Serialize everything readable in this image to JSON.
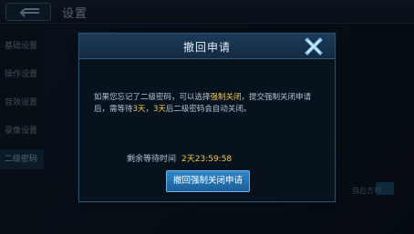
{
  "screen": {
    "title": "设置",
    "sidebar": [
      "基础设置",
      "操作设置",
      "音效设置",
      "录像设置",
      "二级密码"
    ],
    "active_sidebar_index": 4,
    "bg_fragment": "自后方可"
  },
  "dialog": {
    "title": "撤回申请",
    "message_part1": "如果您忘记了二级密码，可以选择",
    "message_hl1": "强制关闭",
    "message_part2": "，提交强制关闭申请后，需等待",
    "message_hl2": "3天",
    "message_part3": "，",
    "message_hl3": "3天",
    "message_part4": "后二级密码会自动关闭。",
    "remaining_label": "剩余等待时间",
    "remaining_time": "2天23:59:58",
    "revoke_button": "撤回强制关闭申请"
  },
  "colors": {
    "accent_yellow": "#f2c94c",
    "button_blue": "#2f86c9",
    "header_blue": "#1d3a57"
  },
  "icons": {
    "back": "back-arrow-icon",
    "close": "close-x-icon"
  }
}
